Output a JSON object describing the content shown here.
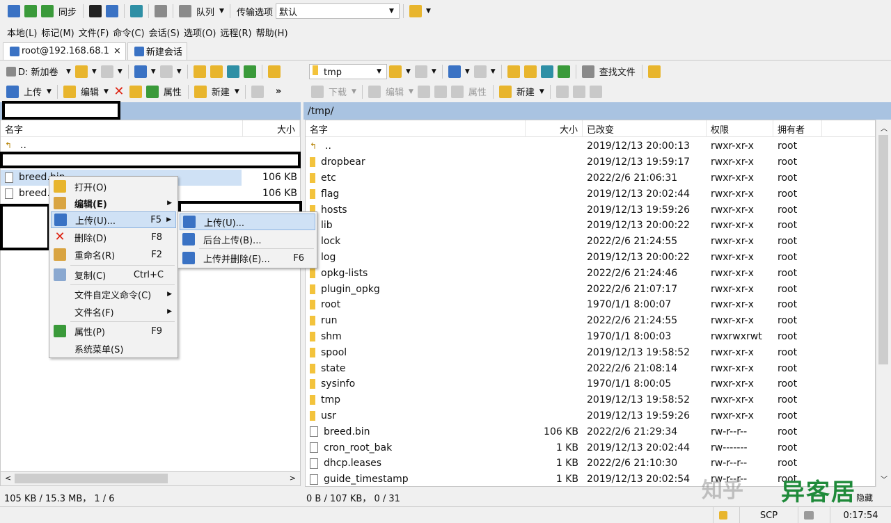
{
  "toolbar": {
    "sync_label": "同步",
    "queue_label": "队列",
    "transfer_options_label": "传输选项",
    "transfer_preset": "默认"
  },
  "menubar": [
    "本地(L)",
    "标记(M)",
    "文件(F)",
    "命令(C)",
    "会话(S)",
    "选项(O)",
    "远程(R)",
    "帮助(H)"
  ],
  "tabs": [
    {
      "label": "root@192.168.68.1",
      "close": "×"
    },
    {
      "label": "新建会话"
    }
  ],
  "left": {
    "drive": "D: 新加卷",
    "upload_label": "上传",
    "edit_label": "编辑",
    "properties_label": "属性",
    "new_label": "新建",
    "more": "»",
    "columns": {
      "name": "名字",
      "size": "大小"
    },
    "rows": [
      {
        "name": "..",
        "size": ""
      },
      {
        "name": "breed.bin",
        "size": "106 KB"
      },
      {
        "name": "breed.bin",
        "size": "106 KB"
      }
    ],
    "status": "105 KB / 15.3 MB， 1 / 6"
  },
  "right": {
    "folder": "tmp",
    "find_files_label": "查找文件",
    "download_label": "下载",
    "edit_label": "编辑",
    "properties_label": "属性",
    "new_label": "新建",
    "path": "/tmp/",
    "columns": {
      "name": "名字",
      "size": "大小",
      "modified": "已改变",
      "perms": "权限",
      "owner": "拥有者"
    },
    "rows": [
      {
        "type": "up",
        "name": "..",
        "size": "",
        "modified": "2019/12/13 20:00:13",
        "perms": "rwxr-xr-x",
        "owner": "root"
      },
      {
        "type": "folder",
        "name": "dropbear",
        "size": "",
        "modified": "2019/12/13 19:59:17",
        "perms": "rwxr-xr-x",
        "owner": "root"
      },
      {
        "type": "folder",
        "name": "etc",
        "size": "",
        "modified": "2022/2/6 21:06:31",
        "perms": "rwxr-xr-x",
        "owner": "root"
      },
      {
        "type": "folder",
        "name": "flag",
        "size": "",
        "modified": "2019/12/13 20:02:44",
        "perms": "rwxr-xr-x",
        "owner": "root"
      },
      {
        "type": "folder",
        "name": "hosts",
        "size": "",
        "modified": "2019/12/13 19:59:26",
        "perms": "rwxr-xr-x",
        "owner": "root"
      },
      {
        "type": "folder",
        "name": "lib",
        "size": "",
        "modified": "2019/12/13 20:00:22",
        "perms": "rwxr-xr-x",
        "owner": "root"
      },
      {
        "type": "folder",
        "name": "lock",
        "size": "",
        "modified": "2022/2/6 21:24:55",
        "perms": "rwxr-xr-x",
        "owner": "root"
      },
      {
        "type": "folder",
        "name": "log",
        "size": "",
        "modified": "2019/12/13 20:00:22",
        "perms": "rwxr-xr-x",
        "owner": "root"
      },
      {
        "type": "folder",
        "name": "opkg-lists",
        "size": "",
        "modified": "2022/2/6 21:24:46",
        "perms": "rwxr-xr-x",
        "owner": "root"
      },
      {
        "type": "folder",
        "name": "plugin_opkg",
        "size": "",
        "modified": "2022/2/6 21:07:17",
        "perms": "rwxr-xr-x",
        "owner": "root"
      },
      {
        "type": "folder",
        "name": "root",
        "size": "",
        "modified": "1970/1/1 8:00:07",
        "perms": "rwxr-xr-x",
        "owner": "root"
      },
      {
        "type": "folder",
        "name": "run",
        "size": "",
        "modified": "2022/2/6 21:24:55",
        "perms": "rwxr-xr-x",
        "owner": "root"
      },
      {
        "type": "folder",
        "name": "shm",
        "size": "",
        "modified": "1970/1/1 8:00:03",
        "perms": "rwxrwxrwt",
        "owner": "root"
      },
      {
        "type": "folder",
        "name": "spool",
        "size": "",
        "modified": "2019/12/13 19:58:52",
        "perms": "rwxr-xr-x",
        "owner": "root"
      },
      {
        "type": "folder",
        "name": "state",
        "size": "",
        "modified": "2022/2/6 21:08:14",
        "perms": "rwxr-xr-x",
        "owner": "root"
      },
      {
        "type": "folder",
        "name": "sysinfo",
        "size": "",
        "modified": "1970/1/1 8:00:05",
        "perms": "rwxr-xr-x",
        "owner": "root"
      },
      {
        "type": "folder",
        "name": "tmp",
        "size": "",
        "modified": "2019/12/13 19:58:52",
        "perms": "rwxr-xr-x",
        "owner": "root"
      },
      {
        "type": "folder",
        "name": "usr",
        "size": "",
        "modified": "2019/12/13 19:59:26",
        "perms": "rwxr-xr-x",
        "owner": "root"
      },
      {
        "type": "file",
        "name": "breed.bin",
        "size": "106 KB",
        "modified": "2022/2/6 21:29:34",
        "perms": "rw-r--r--",
        "owner": "root"
      },
      {
        "type": "file",
        "name": "cron_root_bak",
        "size": "1 KB",
        "modified": "2019/12/13 20:02:44",
        "perms": "rw-------",
        "owner": "root"
      },
      {
        "type": "file",
        "name": "dhcp.leases",
        "size": "1 KB",
        "modified": "2022/2/6 21:10:30",
        "perms": "rw-r--r--",
        "owner": "root"
      },
      {
        "type": "file",
        "name": "guide_timestamp",
        "size": "1 KB",
        "modified": "2019/12/13 20:02:54",
        "perms": "rw-r--r--",
        "owner": "root"
      }
    ],
    "status": "0 B / 107 KB， 0 / 31"
  },
  "context_menu": {
    "items": [
      {
        "label": "打开(O)",
        "shortcut": "",
        "submenu": false,
        "icon": "open-folder-icon"
      },
      {
        "label": "编辑(E)",
        "shortcut": "",
        "submenu": true,
        "icon": "edit-icon",
        "bold": true
      },
      {
        "label": "上传(U)...",
        "shortcut": "F5",
        "submenu": true,
        "icon": "upload-icon",
        "highlight": true
      },
      {
        "label": "删除(D)",
        "shortcut": "F8",
        "submenu": false,
        "icon": "delete-icon"
      },
      {
        "label": "重命名(R)",
        "shortcut": "F2",
        "submenu": false,
        "icon": "rename-icon"
      },
      {
        "label": "复制(C)",
        "shortcut": "Ctrl+C",
        "submenu": false,
        "icon": "copy-icon"
      },
      {
        "label": "文件自定义命令(C)",
        "shortcut": "",
        "submenu": true,
        "icon": ""
      },
      {
        "label": "文件名(F)",
        "shortcut": "",
        "submenu": true,
        "icon": ""
      },
      {
        "label": "属性(P)",
        "shortcut": "F9",
        "submenu": false,
        "icon": "properties-icon"
      },
      {
        "label": "系统菜单(S)",
        "shortcut": "",
        "submenu": false,
        "icon": ""
      }
    ]
  },
  "submenu": {
    "items": [
      {
        "label": "上传(U)...",
        "shortcut": "",
        "highlight": true
      },
      {
        "label": "后台上传(B)...",
        "shortcut": ""
      },
      {
        "label": "上传并删除(E)...",
        "shortcut": "F6"
      }
    ]
  },
  "statusbar": {
    "protocol": "SCP",
    "time": "0:17:54",
    "hidden_label": "隐藏"
  },
  "watermark": {
    "left": "知乎",
    "right": "异客居"
  },
  "colors": {
    "path_bar": "#a9c3e1",
    "selection": "#cfe1f5",
    "folder": "#f3c33c",
    "delete_red": "#dd2211",
    "watermark_green": "#1f8a3a"
  }
}
